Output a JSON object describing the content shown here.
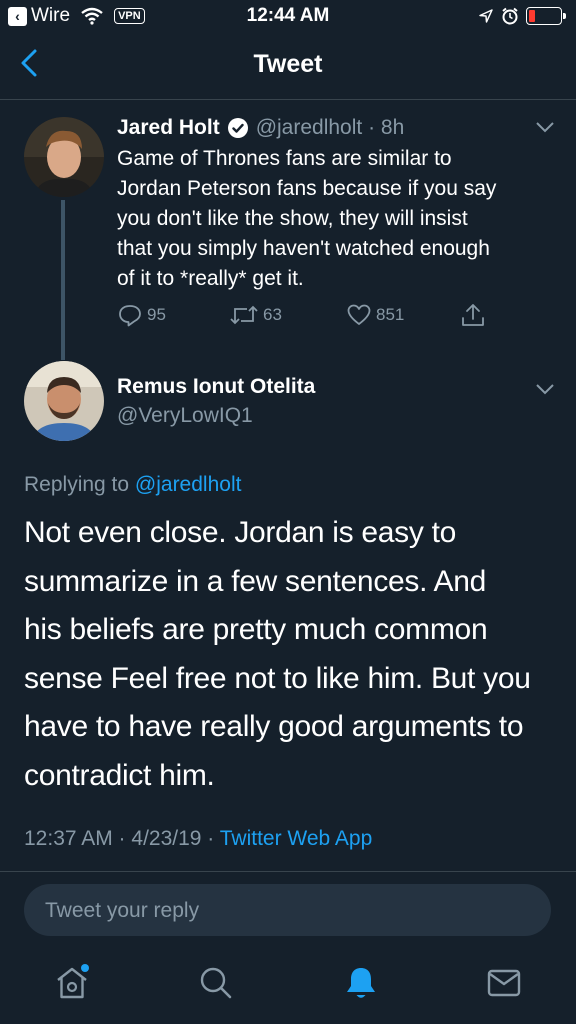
{
  "status_bar": {
    "back_app": "Wire",
    "vpn": "VPN",
    "time": "12:44 AM"
  },
  "header": {
    "title": "Tweet"
  },
  "parent_tweet": {
    "name": "Jared Holt",
    "meta": "@jaredlholt · 8h",
    "lines": [
      "Game of Thrones fans are similar to",
      "Jordan Peterson fans because if you say",
      "you don't like the show, they will insist",
      "that you simply haven't watched enough",
      "of it to *really* get it."
    ],
    "replies": "95",
    "retweets": "63",
    "likes": "851"
  },
  "main_tweet": {
    "name": "Remus Ionut Otelita",
    "handle": "@VeryLowIQ1",
    "replying_prefix": "Replying to",
    "replying_handle": "@jaredlholt",
    "lines": [
      "Not even close. Jordan is easy to",
      "summarize in a few sentences. And",
      "his beliefs are pretty much common",
      "sense Feel free not to like him. But you",
      "have to have really good arguments to",
      "contradict him."
    ],
    "timestamp": "12:37 AM · 4/23/19 · ",
    "source": "Twitter Web App"
  },
  "reply_input": {
    "placeholder": "Tweet your reply"
  },
  "tab_bar": {
    "items": [
      "home-icon",
      "search-icon",
      "notifications-icon",
      "messages-icon"
    ]
  },
  "colors": {
    "background": "#15202b",
    "accent": "#1da1f2",
    "muted": "#8899a6"
  }
}
